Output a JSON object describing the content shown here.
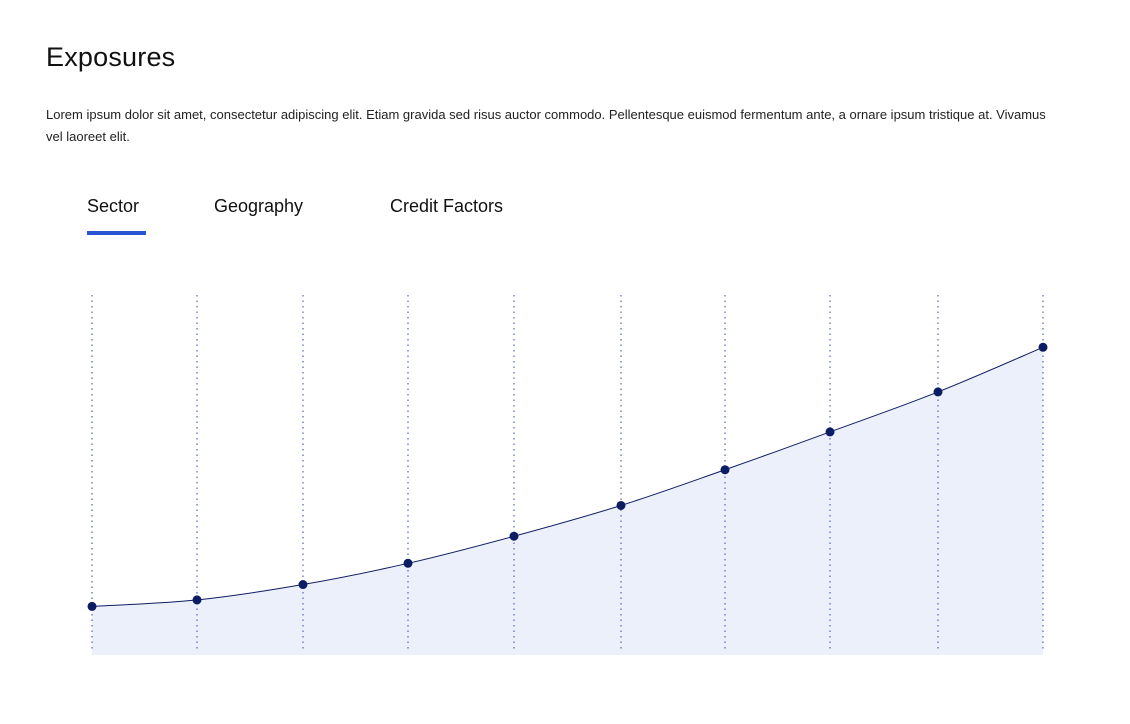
{
  "page": {
    "title": "Exposures",
    "description": "Lorem ipsum dolor sit amet, consectetur adipiscing elit. Etiam gravida sed risus auctor commodo. Pellentesque euismod fermentum ante, a ornare ipsum tristique at. Vivamus vel laoreet elit."
  },
  "tabs": [
    {
      "label": "Sector",
      "active": true
    },
    {
      "label": "Geography",
      "active": false
    },
    {
      "label": "Credit Factors",
      "active": false
    }
  ],
  "colors": {
    "accent": "#2a54d4",
    "line": "#0d1d63",
    "point": "#0d1d63",
    "area_fill": "#ecf0fa",
    "gridline": "#5566b8"
  },
  "chart_data": {
    "type": "area",
    "x": [
      1,
      2,
      3,
      4,
      5,
      6,
      7,
      8,
      9,
      10
    ],
    "values": [
      0.8,
      2.9,
      7.9,
      14.8,
      23.6,
      33.6,
      45.2,
      57.5,
      70.5,
      85.0
    ],
    "ylim": [
      -15,
      102
    ],
    "grid": "vertical-dotted",
    "title": "",
    "xlabel": "",
    "ylabel": ""
  }
}
